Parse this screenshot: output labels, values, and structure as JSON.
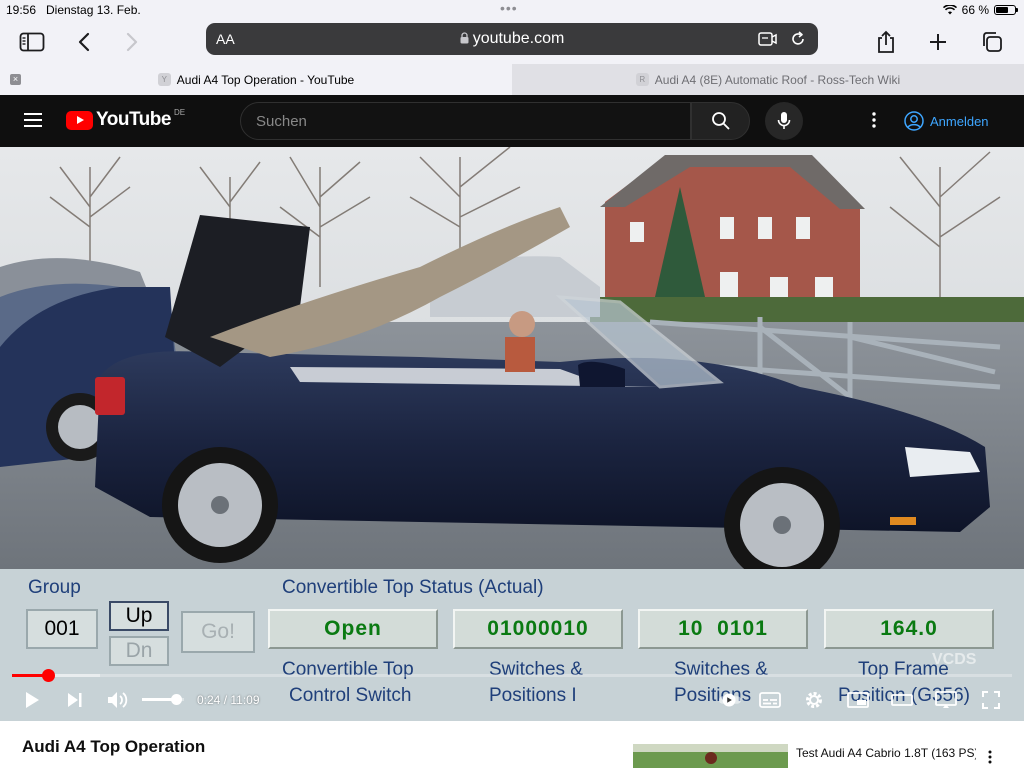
{
  "status_bar": {
    "time": "19:56",
    "date": "Dienstag 13. Feb.",
    "battery": "66 %",
    "battery_level": 0.66
  },
  "browser": {
    "address_prefix": "AA",
    "url": "youtube.com",
    "tabs": [
      {
        "label": "Audi A4 Top Operation - YouTube",
        "favicon": "Y",
        "active": true
      },
      {
        "label": "Audi A4 (8E) Automatic Roof - Ross-Tech Wiki",
        "favicon": "R",
        "active": false
      }
    ]
  },
  "youtube": {
    "logo_text": "YouTube",
    "country_code": "DE",
    "search_placeholder": "Suchen",
    "sign_in": "Anmelden"
  },
  "video_overlay": {
    "group_label": "Group",
    "group_value": "001",
    "up_button": "Up",
    "down_button": "Dn",
    "go_button": "Go!",
    "status_heading": "Convertible Top Status (Actual)",
    "values": [
      "Open",
      "01000010",
      "10  0101",
      "164.0"
    ],
    "labels": [
      {
        "line1": "Convertible Top",
        "line2": "Control Switch"
      },
      {
        "line1": "Switches &",
        "line2": "Positions I"
      },
      {
        "line1": "Switches &",
        "line2": "Positions"
      },
      {
        "line1": "Top Frame",
        "line2": "Position (G356)"
      }
    ],
    "watermark": "VCDS"
  },
  "player": {
    "current_time": "0:24",
    "duration": "11:09",
    "time_display": "0:24 / 11:09",
    "progress_fraction": 0.036,
    "buffered_fraction": 0.088,
    "volume_fraction": 0.8
  },
  "page": {
    "video_title": "Audi A4 Top Operation",
    "recommended": [
      {
        "title": "Test Audi A4 Cabrio 1.8T (163 PS)"
      }
    ]
  },
  "colors": {
    "youtube_red": "#ff0000",
    "header_bg": "#0f0f0f",
    "signin_blue": "#3ea6ff",
    "vcds_value_green": "#0a7a12",
    "vcds_label_blue": "#1f3f7a"
  }
}
